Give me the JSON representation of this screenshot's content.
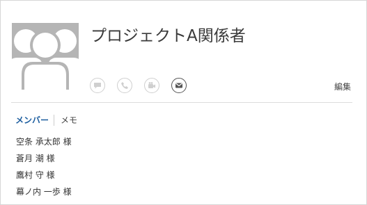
{
  "group": {
    "title": "プロジェクトA関係者"
  },
  "actions": [
    {
      "name": "chat",
      "icon": "chat-icon",
      "enabled": false
    },
    {
      "name": "call",
      "icon": "phone-icon",
      "enabled": false
    },
    {
      "name": "video",
      "icon": "video-icon",
      "enabled": false
    },
    {
      "name": "email",
      "icon": "mail-icon",
      "enabled": true
    }
  ],
  "edit_label": "編集",
  "tabs": {
    "members_label": "メンバー",
    "notes_label": "メモ",
    "active": "members"
  },
  "members": [
    "空条 承太郎 様",
    "蒼月 潮 様",
    "鷹村 守 様",
    "幕ノ内 一歩 様"
  ],
  "colors": {
    "accent": "#1a5c9e",
    "avatar_bg": "#b5b5b5",
    "icon_disabled": "#cfcfcf",
    "icon_enabled": "#555555"
  }
}
